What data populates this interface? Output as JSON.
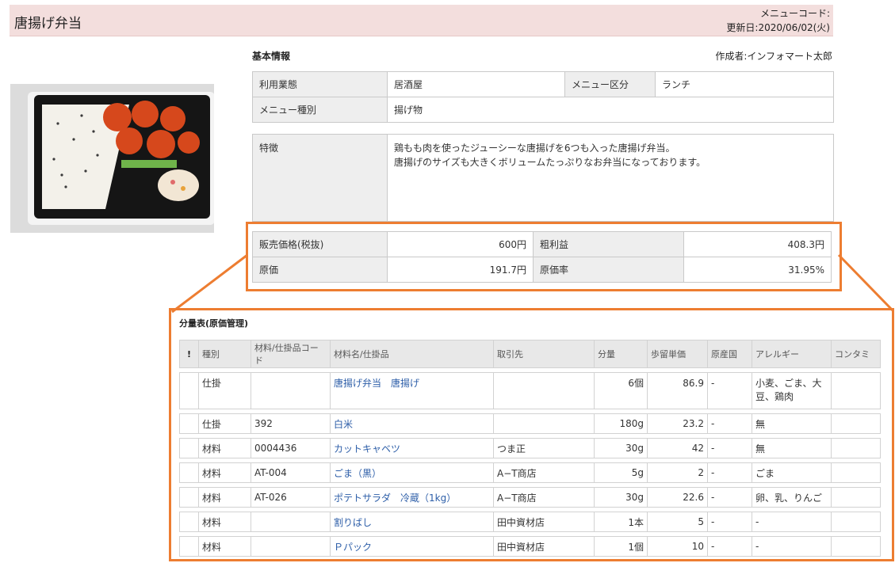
{
  "header": {
    "title": "唐揚げ弁当",
    "menu_code_label": "メニューコード:",
    "updated": "更新日:2020/06/02(火)"
  },
  "photo": {
    "icon": "bento-photo-icon"
  },
  "basic": {
    "title": "基本情報",
    "author": "作成者:インフォマート太郎",
    "usage_label": "利用業態",
    "usage_value": "居酒屋",
    "category_label": "メニュー区分",
    "category_value": "ランチ",
    "type_label": "メニュー種別",
    "type_value": "揚げ物",
    "feature_label": "特徴",
    "feature_line1": "鶏もも肉を使ったジューシーな唐揚げを6つも入った唐揚げ弁当。",
    "feature_line2": "唐揚げのサイズも大きくボリュームたっぷりなお弁当になっております。"
  },
  "price": {
    "sale_label": "販売価格(税抜)",
    "sale_value": "600円",
    "profit_label": "粗利益",
    "profit_value": "408.3円",
    "cost_label": "原価",
    "cost_value": "191.7円",
    "rate_label": "原価率",
    "rate_value": "31.95%"
  },
  "accent_color": "#ed7d31",
  "qty": {
    "title": "分量表(原価管理)",
    "headers": {
      "mark": "!",
      "kind": "種別",
      "code": "材料/仕掛品コード",
      "name": "材料名/仕掛品",
      "supplier": "取引先",
      "amount": "分量",
      "unit_price": "歩留単価",
      "origin": "原産国",
      "allergy": "アレルギー",
      "contam": "コンタミ"
    },
    "rows": [
      {
        "kind": "仕掛",
        "code": "",
        "name": "唐揚げ弁当　唐揚げ",
        "supplier": "",
        "amount": "6個",
        "unit_price": "86.9",
        "origin": "-",
        "allergy1": "小麦、ごま、大",
        "allergy2": "豆、鶏肉"
      },
      {
        "kind": "仕掛",
        "code": "392",
        "name": "白米",
        "supplier": "",
        "amount": "180g",
        "unit_price": "23.2",
        "origin": "-",
        "allergy1": "無"
      },
      {
        "kind": "材料",
        "code": "0004436",
        "name": "カットキャベツ",
        "supplier": "つま正",
        "amount": "30g",
        "unit_price": "42",
        "origin": "-",
        "allergy1": "無"
      },
      {
        "kind": "材料",
        "code": "AT-004",
        "name": "ごま（黒）",
        "supplier": "A−T商店",
        "amount": "5g",
        "unit_price": "2",
        "origin": "-",
        "allergy1": "ごま"
      },
      {
        "kind": "材料",
        "code": "AT-026",
        "name": "ポテトサラダ　冷蔵（1kg）",
        "supplier": "A−T商店",
        "amount": "30g",
        "unit_price": "22.6",
        "origin": "-",
        "allergy1": "卵、乳、りんご"
      },
      {
        "kind": "材料",
        "code": "",
        "name": "割りばし",
        "supplier": "田中資材店",
        "amount": "1本",
        "unit_price": "5",
        "origin": "-",
        "allergy1": "-"
      },
      {
        "kind": "材料",
        "code": "",
        "name": "Ｐパック",
        "supplier": "田中資材店",
        "amount": "1個",
        "unit_price": "10",
        "origin": "-",
        "allergy1": "-"
      }
    ]
  }
}
